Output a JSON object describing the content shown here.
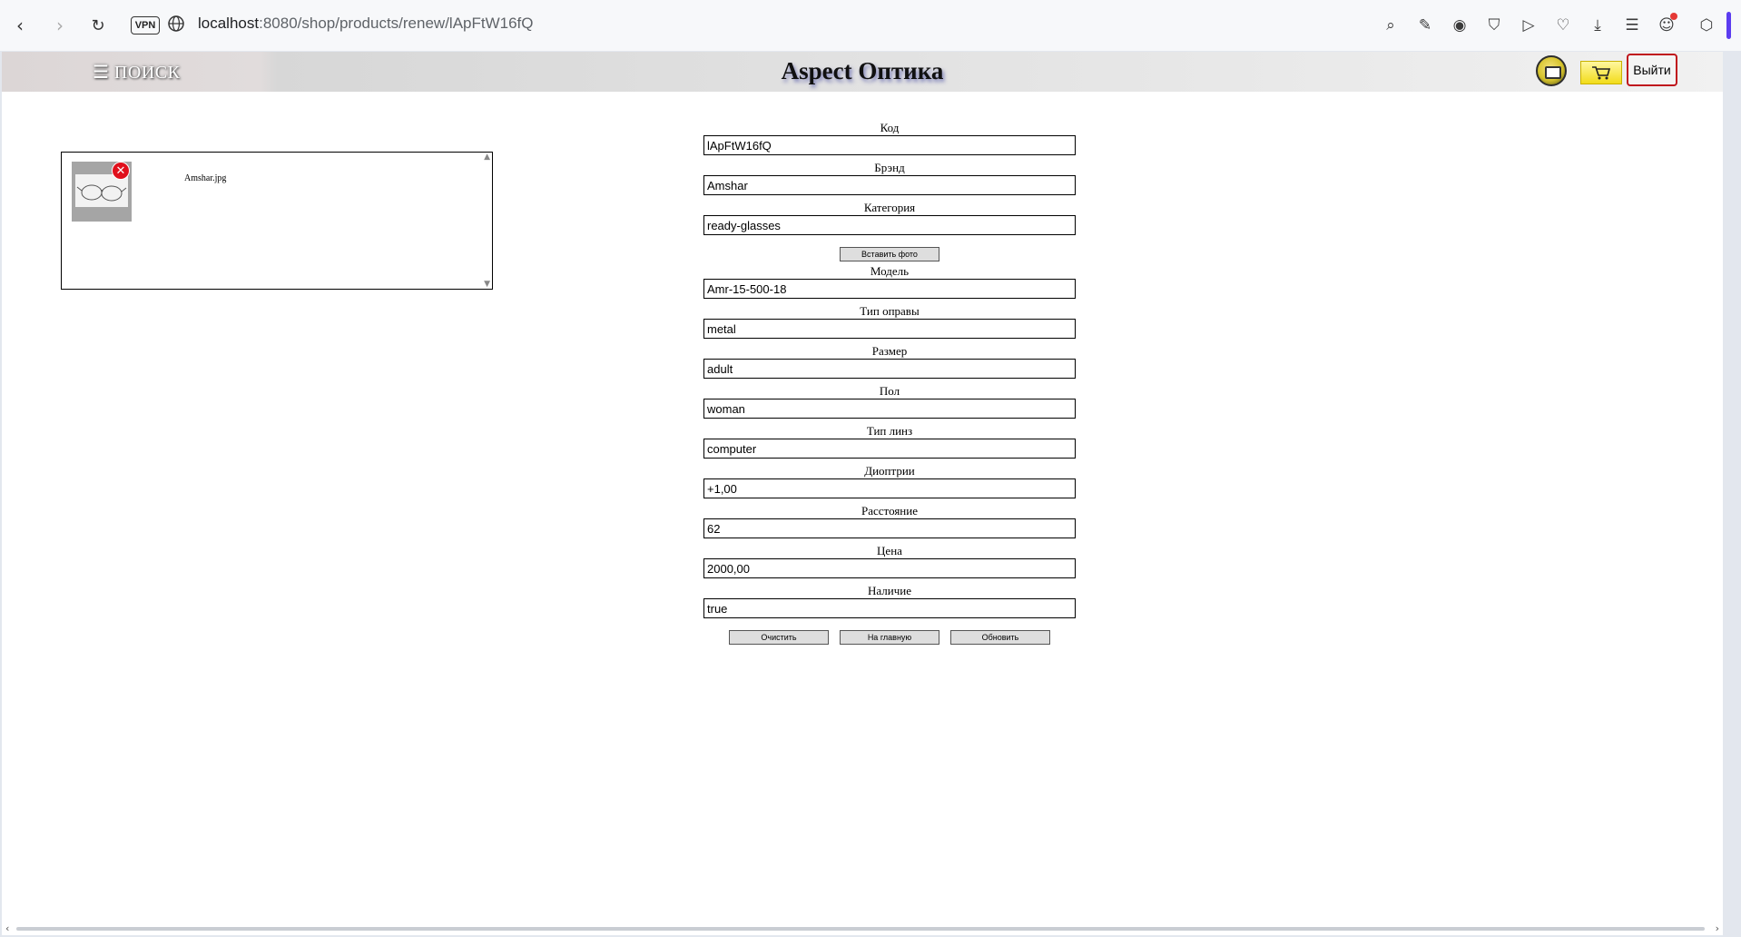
{
  "browser": {
    "vpn_label": "VPN",
    "url_host": "localhost",
    "url_rest": ":8080/shop/products/renew/lApFtW16fQ",
    "tools": [
      "search-page-icon",
      "edit-icon",
      "camera-icon",
      "shield-icon",
      "send-icon",
      "heart-icon",
      "download-icon",
      "menu-icon",
      "profile-icon"
    ]
  },
  "header": {
    "menu_label": "☰ ПОИСК",
    "title": "Aspect Оптика",
    "logout_label": "Выйти"
  },
  "photos": {
    "items": [
      {
        "file_name": "Amshar.jpg"
      }
    ]
  },
  "form": {
    "fields": [
      {
        "label": "Код",
        "value": "lApFtW16fQ"
      },
      {
        "label": "Брэнд",
        "value": "Amshar"
      },
      {
        "label": "Категория",
        "value": "ready-glasses"
      },
      {
        "label": "Модель",
        "value": "Amr-15-500-18"
      },
      {
        "label": "Тип оправы",
        "value": "metal"
      },
      {
        "label": "Размер",
        "value": "adult"
      },
      {
        "label": "Пол",
        "value": "woman"
      },
      {
        "label": "Тип линз",
        "value": "computer"
      },
      {
        "label": "Диоптрии",
        "value": "+1,00"
      },
      {
        "label": "Расстояние",
        "value": "62"
      },
      {
        "label": "Цена",
        "value": "2000,00"
      },
      {
        "label": "Наличие",
        "value": "true"
      }
    ],
    "insert_photo_label": "Вставить фото",
    "clear_label": "Очистить",
    "home_label": "На главную",
    "update_label": "Обновить"
  }
}
